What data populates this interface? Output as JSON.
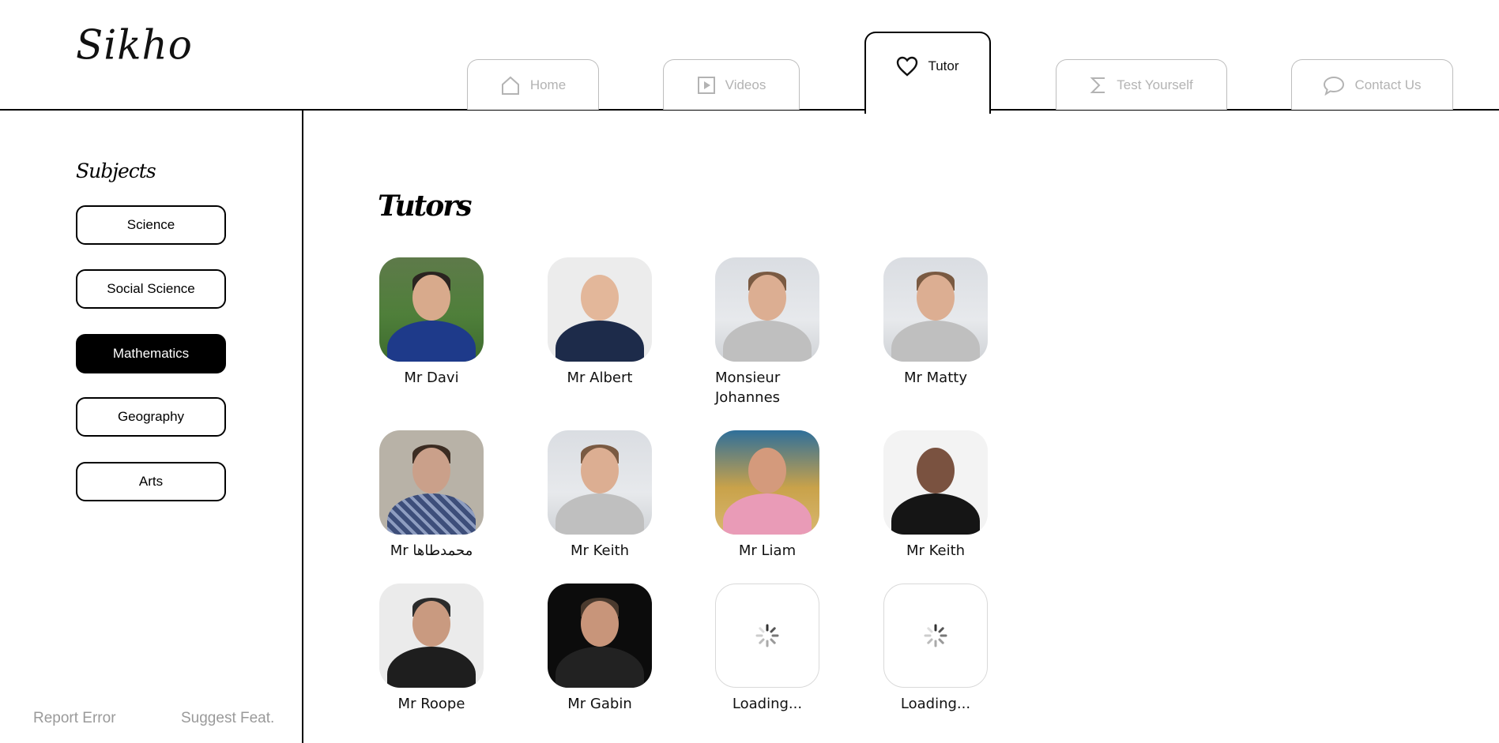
{
  "header": {
    "logo": "Sikho",
    "tabs": [
      {
        "label": "Home",
        "icon": "home-icon"
      },
      {
        "label": "Videos",
        "icon": "video-play-icon"
      },
      {
        "label": "Tutor",
        "icon": "heart-icon",
        "active": true
      },
      {
        "label": "Test Yourself",
        "icon": "sigma-icon"
      },
      {
        "label": "Contact Us",
        "icon": "chat-bubble-icon"
      }
    ]
  },
  "sidebar": {
    "title": "Subjects",
    "subjects": [
      {
        "label": "Science"
      },
      {
        "label": "Social Science"
      },
      {
        "label": "Mathematics",
        "active": true
      },
      {
        "label": "Geography"
      },
      {
        "label": "Arts"
      }
    ],
    "footer": {
      "report": "Report Error",
      "suggest": "Suggest Feat."
    }
  },
  "main": {
    "title": "Tutors",
    "tutors": [
      {
        "name": "Mr Davi"
      },
      {
        "name": "Mr Albert"
      },
      {
        "name": "Monsieur Johannes"
      },
      {
        "name": "Mr Matty"
      },
      {
        "name": "Mr محمدطاها"
      },
      {
        "name": "Mr Keith"
      },
      {
        "name": "Mr Liam"
      },
      {
        "name": "Mr Keith"
      },
      {
        "name": "Mr Roope"
      },
      {
        "name": "Mr Gabin"
      },
      {
        "name": "Loading..."
      },
      {
        "name": "Loading..."
      }
    ]
  },
  "colors": {
    "accent": "#000000",
    "inactive_tab": "#b3b3b3",
    "footer_link": "#9a9a9a"
  }
}
